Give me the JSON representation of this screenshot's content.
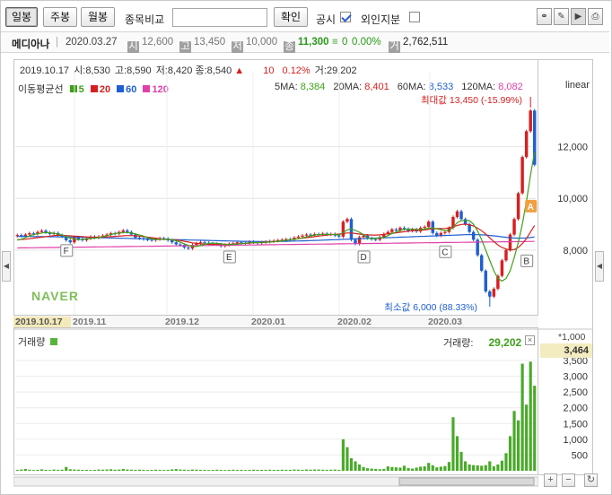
{
  "toolbar": {
    "period_buttons": [
      "일봉",
      "주봉",
      "월봉"
    ],
    "compare_label": "종목비교",
    "compare_input": "",
    "confirm_label": "확인",
    "disclosure_label": "공시",
    "disclosure_checked": true,
    "foreign_label": "외인지분",
    "foreign_checked": false
  },
  "stock": {
    "name": "메디아나",
    "date": "2020.03.27",
    "open_badge": "시",
    "open": "12,600",
    "high_badge": "고",
    "high": "13,450",
    "low_badge": "저",
    "low": "10,000",
    "close_badge": "종",
    "close": "11,300",
    "change_sign": "≡",
    "change": "0",
    "change_pct": "0.00%",
    "volume_badge": "거",
    "volume": "2,762,511"
  },
  "cursor": {
    "date": "2019.10.17",
    "open_label": "시:",
    "open": "8,530",
    "high_label": "고:",
    "high": "8,590",
    "low_label": "저:",
    "low": "8,420",
    "close_label": "종:",
    "close": "8,540",
    "change": "10",
    "change_pct": "0.12%",
    "volume_label": "거:",
    "volume": "29,202"
  },
  "ma": {
    "title": "이동평균선",
    "legend": [
      {
        "label": "5",
        "color": "#3ea019"
      },
      {
        "label": "20",
        "color": "#d62020"
      },
      {
        "label": "60",
        "color": "#1f5fd1"
      },
      {
        "label": "120",
        "color": "#e040a8"
      }
    ],
    "values": [
      {
        "label": "5MA:",
        "value": "8,384",
        "color": "#3ea019"
      },
      {
        "label": "20MA:",
        "value": "8,401",
        "color": "#d62020"
      },
      {
        "label": "60MA:",
        "value": "8,533",
        "color": "#1f5fd1"
      },
      {
        "label": "120MA:",
        "value": "8,082",
        "color": "#e040a8"
      }
    ]
  },
  "scale_label": "linear",
  "price_ticks": [
    "12,000",
    "10,000",
    "8,000"
  ],
  "annotations": {
    "max_label": "최대값 13,450 (-15.99%)",
    "min_label": "최소값 6,000 (88.33%)"
  },
  "markers": [
    "F",
    "E",
    "D",
    "C",
    "B",
    "A"
  ],
  "brand": "NAVER",
  "x_labels": [
    "2019.10.17",
    "2019.11",
    "2019.12",
    "2020.01",
    "2020.02",
    "2020.03"
  ],
  "volume": {
    "title": "거래량",
    "current_label": "거래량:",
    "current_value": "29,202",
    "unit": "*1,000",
    "highlight": "3,464",
    "ticks": [
      "3,500",
      "3,000",
      "2,500",
      "2,000",
      "1,500",
      "1,000",
      "500"
    ]
  },
  "chart_data": {
    "type": "candlestick",
    "y_range": [
      5600,
      14000
    ],
    "closes": [
      8580,
      8540,
      8600,
      8650,
      8620,
      8700,
      8750,
      8680,
      8620,
      8660,
      8580,
      8520,
      8380,
      8300,
      8500,
      8420,
      8380,
      8450,
      8520,
      8480,
      8520,
      8560,
      8600,
      8650,
      8630,
      8700,
      8760,
      8700,
      8600,
      8480,
      8450,
      8420,
      8400,
      8380,
      8420,
      8460,
      8440,
      8380,
      8300,
      8220,
      8200,
      8100,
      8060,
      8200,
      8260,
      8300,
      8280,
      8250,
      8240,
      8220,
      8150,
      8200,
      8240,
      8260,
      8300,
      8280,
      8260,
      8320,
      8300,
      8280,
      8300,
      8320,
      8340,
      8360,
      8380,
      8400,
      8420,
      8400,
      8480,
      8520,
      8560,
      8600,
      8580,
      8620,
      8600,
      8640,
      8600,
      8620,
      8560,
      8520,
      9100,
      9200,
      8400,
      8240,
      8500,
      8560,
      8460,
      8420,
      8400,
      8500,
      8620,
      8700,
      8800,
      8760,
      8860,
      8820,
      8740,
      8800,
      8720,
      8860,
      8900,
      9100,
      8660,
      8560,
      8660,
      8700,
      8860,
      9280,
      9500,
      9200,
      9000,
      8700,
      8400,
      7800,
      7200,
      6400,
      6200,
      6500,
      7000,
      7600,
      8000,
      8600,
      9200,
      10200,
      11600,
      12600,
      13400,
      11300
    ],
    "ma5": [
      8384,
      8420,
      8480,
      8550,
      8600,
      8630,
      8660,
      8680,
      8670,
      8650,
      8620,
      8580,
      8520,
      8460,
      8430,
      8400,
      8420,
      8430,
      8450,
      8460,
      8480,
      8520,
      8560,
      8600,
      8640,
      8660,
      8680,
      8680,
      8660,
      8620,
      8580,
      8540,
      8480,
      8430,
      8410,
      8410,
      8420,
      8420,
      8400,
      8360,
      8310,
      8240,
      8180,
      8140,
      8140,
      8170,
      8220,
      8260,
      8270,
      8260,
      8240,
      8220,
      8210,
      8220,
      8230,
      8250,
      8270,
      8280,
      8290,
      8290,
      8290,
      8300,
      8310,
      8320,
      8340,
      8360,
      8380,
      8400,
      8420,
      8440,
      8470,
      8510,
      8550,
      8580,
      8600,
      8610,
      8610,
      8610,
      8600,
      8580,
      8680,
      8780,
      8820,
      8760,
      8690,
      8600,
      8470,
      8430,
      8460,
      8470,
      8490,
      8560,
      8640,
      8700,
      8760,
      8800,
      8810,
      8810,
      8800,
      8790,
      8810,
      8850,
      8860,
      8820,
      8790,
      8760,
      8760,
      8880,
      9060,
      9140,
      9150,
      9140,
      9000,
      8740,
      8400,
      8000,
      7600,
      7200,
      6900,
      6800,
      6900,
      7200,
      7700,
      8300,
      9000,
      9900,
      10900,
      11800
    ],
    "ma20": [
      8401,
      8410,
      8420,
      8440,
      8460,
      8480,
      8500,
      8520,
      8540,
      8560,
      8570,
      8570,
      8560,
      8550,
      8540,
      8530,
      8520,
      8510,
      8500,
      8500,
      8500,
      8500,
      8510,
      8520,
      8530,
      8540,
      8550,
      8560,
      8560,
      8550,
      8540,
      8520,
      8500,
      8480,
      8460,
      8440,
      8420,
      8410,
      8400,
      8390,
      8370,
      8340,
      8310,
      8280,
      8260,
      8240,
      8230,
      8220,
      8220,
      8220,
      8220,
      8220,
      8220,
      8230,
      8240,
      8250,
      8260,
      8270,
      8280,
      8290,
      8300,
      8310,
      8320,
      8330,
      8340,
      8360,
      8380,
      8400,
      8420,
      8440,
      8460,
      8480,
      8500,
      8520,
      8540,
      8560,
      8580,
      8600,
      8610,
      8620,
      8640,
      8660,
      8660,
      8640,
      8620,
      8600,
      8590,
      8580,
      8580,
      8590,
      8610,
      8630,
      8650,
      8670,
      8690,
      8710,
      8730,
      8750,
      8760,
      8770,
      8780,
      8800,
      8820,
      8830,
      8830,
      8840,
      8860,
      8900,
      8950,
      8990,
      9000,
      8980,
      8930,
      8850,
      8750,
      8620,
      8470,
      8330,
      8200,
      8100,
      8040,
      8000,
      8020,
      8100,
      8250,
      8450,
      8700,
      8950
    ],
    "ma60": [
      8533,
      8530,
      8528,
      8526,
      8524,
      8522,
      8520,
      8518,
      8516,
      8514,
      8512,
      8510,
      8508,
      8506,
      8504,
      8500,
      8496,
      8492,
      8488,
      8484,
      8480,
      8476,
      8472,
      8468,
      8464,
      8460,
      8456,
      8452,
      8448,
      8444,
      8440,
      8436,
      8432,
      8428,
      8424,
      8420,
      8416,
      8412,
      8408,
      8404,
      8400,
      8396,
      8392,
      8388,
      8384,
      8380,
      8376,
      8372,
      8368,
      8364,
      8360,
      8356,
      8352,
      8348,
      8344,
      8340,
      8338,
      8336,
      8334,
      8332,
      8330,
      8330,
      8330,
      8332,
      8334,
      8336,
      8340,
      8344,
      8348,
      8352,
      8356,
      8360,
      8366,
      8372,
      8378,
      8384,
      8390,
      8396,
      8402,
      8408,
      8414,
      8420,
      8426,
      8432,
      8438,
      8444,
      8450,
      8456,
      8462,
      8468,
      8474,
      8480,
      8486,
      8492,
      8498,
      8504,
      8510,
      8516,
      8522,
      8528,
      8534,
      8540,
      8546,
      8552,
      8558,
      8564,
      8570,
      8576,
      8582,
      8588,
      8594,
      8600,
      8600,
      8596,
      8590,
      8580,
      8566,
      8550,
      8532,
      8512,
      8494,
      8478,
      8466,
      8460,
      8462,
      8470,
      8486,
      8510
    ],
    "ma120": [
      8082,
      8084,
      8086,
      8088,
      8090,
      8092,
      8094,
      8096,
      8098,
      8100,
      8102,
      8104,
      8106,
      8108,
      8110,
      8112,
      8114,
      8116,
      8118,
      8120,
      8122,
      8124,
      8126,
      8128,
      8130,
      8132,
      8134,
      8136,
      8138,
      8140,
      8142,
      8144,
      8146,
      8148,
      8150,
      8152,
      8154,
      8156,
      8158,
      8160,
      8162,
      8164,
      8166,
      8168,
      8170,
      8172,
      8174,
      8176,
      8178,
      8180,
      8182,
      8184,
      8186,
      8188,
      8190,
      8192,
      8194,
      8196,
      8198,
      8200,
      8202,
      8204,
      8206,
      8208,
      8210,
      8212,
      8214,
      8216,
      8218,
      8220,
      8222,
      8224,
      8226,
      8228,
      8230,
      8232,
      8234,
      8236,
      8238,
      8240,
      8242,
      8244,
      8246,
      8248,
      8250,
      8252,
      8254,
      8256,
      8258,
      8260,
      8262,
      8264,
      8266,
      8268,
      8270,
      8272,
      8274,
      8276,
      8278,
      8280,
      8282,
      8284,
      8286,
      8288,
      8290,
      8292,
      8294,
      8296,
      8298,
      8300,
      8302,
      8304,
      8306,
      8308,
      8310,
      8312,
      8314,
      8316,
      8318,
      8320,
      8322,
      8324,
      8326,
      8328,
      8330,
      8332,
      8334,
      8336
    ],
    "volumes": [
      30,
      40,
      60,
      35,
      25,
      30,
      45,
      30,
      25,
      40,
      30,
      35,
      120,
      50,
      40,
      35,
      30,
      30,
      25,
      30,
      40,
      35,
      40,
      50,
      35,
      40,
      60,
      40,
      35,
      30,
      35,
      30,
      25,
      30,
      35,
      30,
      25,
      30,
      45,
      55,
      40,
      35,
      30,
      40,
      35,
      30,
      30,
      25,
      30,
      35,
      30,
      25,
      30,
      35,
      30,
      30,
      25,
      30,
      35,
      30,
      30,
      30,
      35,
      30,
      30,
      35,
      30,
      30,
      40,
      35,
      30,
      40,
      35,
      40,
      40,
      35,
      30,
      35,
      40,
      30,
      1000,
      750,
      400,
      300,
      200,
      120,
      80,
      70,
      60,
      50,
      60,
      140,
      120,
      110,
      100,
      160,
      90,
      70,
      100,
      130,
      140,
      250,
      170,
      110,
      130,
      150,
      280,
      1700,
      1100,
      600,
      300,
      200,
      180,
      170,
      160,
      180,
      300,
      140,
      200,
      320,
      560,
      1100,
      1900,
      1600,
      3400,
      2100,
      3464,
      2700
    ],
    "vol_range": [
      0,
      3700
    ]
  }
}
